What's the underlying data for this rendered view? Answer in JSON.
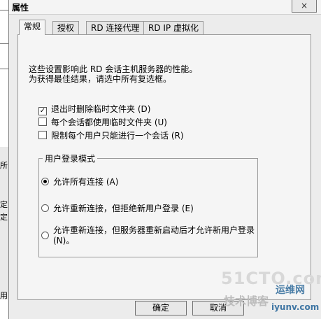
{
  "background": {
    "fragments": [
      "所",
      "定",
      "定",
      "用"
    ]
  },
  "window": {
    "title": "属性",
    "close_label": "×"
  },
  "tabs": [
    {
      "label": "常规",
      "active": true
    },
    {
      "label": "授权",
      "active": false
    },
    {
      "label": "RD 连接代理",
      "active": false
    },
    {
      "label": "RD IP 虚拟化",
      "active": false
    }
  ],
  "description": {
    "line1": "这些设置影响此 RD 会话主机服务器的性能。",
    "line2": "为获得最佳结果，请选中所有复选框。"
  },
  "checkboxes": [
    {
      "label": "退出时删除临时文件夹 (D)",
      "checked": true
    },
    {
      "label": "每个会话都使用临时文件夹 (U)",
      "checked": false
    },
    {
      "label": "限制每个用户只能进行一个会话 (R)",
      "checked": false
    }
  ],
  "logon_mode": {
    "legend": "用户登录模式",
    "options": [
      {
        "label": "允许所有连接 (A)",
        "selected": true
      },
      {
        "label": "允许重新连接，但拒绝新用户登录 (E)",
        "selected": false
      },
      {
        "label_line1": "允许重新连接，但服务器重新启动后才允许新用户登录",
        "label_line2": "(N)。",
        "selected": false
      }
    ]
  },
  "buttons": {
    "ok": "确定",
    "cancel": "取消"
  },
  "watermark": {
    "brand": "51CTO.com",
    "sub": "技术博客",
    "cn": "运维网",
    "url": "iyunv.com"
  },
  "colors": {
    "dialog_bg": "#ececec",
    "panel_bg": "#f5f5f5",
    "watermark_blue": "#3e75a3"
  }
}
